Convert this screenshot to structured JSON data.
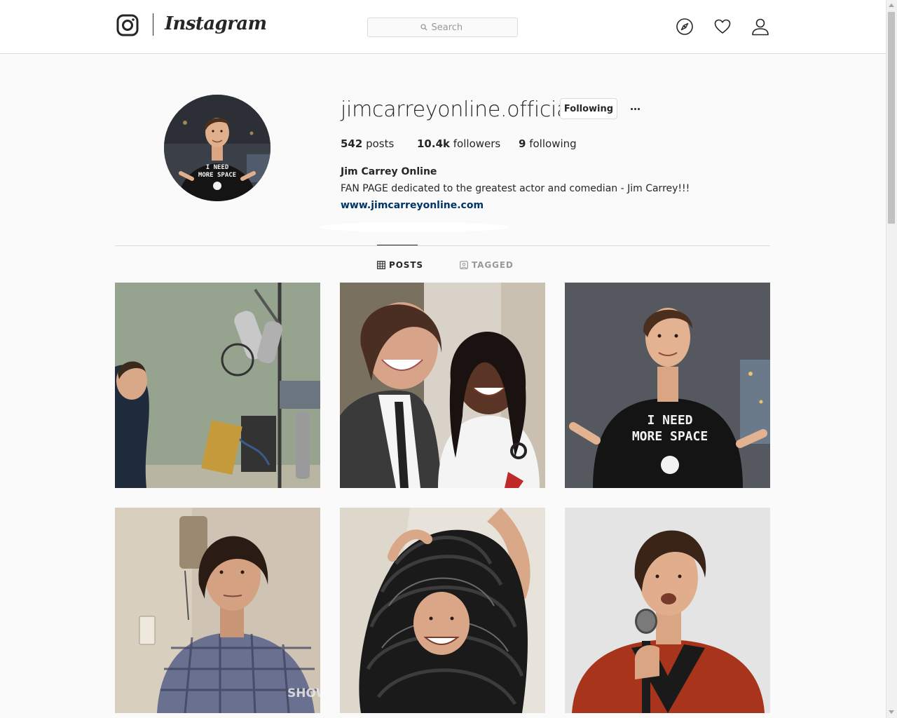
{
  "header": {
    "brand": "Instagram",
    "search": {
      "placeholder": "Search",
      "value": ""
    },
    "icons": [
      "instagram-glyph-icon",
      "compass-icon",
      "heart-icon",
      "person-icon",
      "search-icon"
    ]
  },
  "profile": {
    "username": "jimcarreyonline.official",
    "follow_button": "Following",
    "stats": {
      "posts_count": "542",
      "posts_label": "posts",
      "followers_count": "10.4k",
      "followers_label": "followers",
      "following_count": "9",
      "following_label": "following"
    },
    "full_name": "Jim Carrey Online",
    "bio": "FAN PAGE dedicated to the greatest actor and comedian - Jim Carrey!!!",
    "website": "www.jimcarreyonline.com",
    "avatar_shirt_text": "I NEED\nMORE SPACE"
  },
  "tabs": [
    {
      "label": "POSTS",
      "icon": "grid-icon",
      "active": true
    },
    {
      "label": "TAGGED",
      "icon": "tag-icon",
      "active": false
    }
  ],
  "posts": [
    {
      "description": "man at recording studio microphone",
      "overlay_text": ""
    },
    {
      "description": "selfie of two smiling people",
      "overlay_text": ""
    },
    {
      "description": "man in black t-shirt pointing",
      "overlay_text": "I NEED\nMORE SPACE"
    },
    {
      "description": "man in plaid shirt by wall phone",
      "overlay_text": "SHOWT"
    },
    {
      "description": "man wrapped in film reels",
      "overlay_text": ""
    },
    {
      "description": "man in red jacket holding microphone",
      "overlay_text": ""
    }
  ],
  "colors": {
    "link": "#003569",
    "border": "#dbdbdb",
    "muted": "#999999",
    "text": "#262626",
    "background": "#fafafa"
  }
}
